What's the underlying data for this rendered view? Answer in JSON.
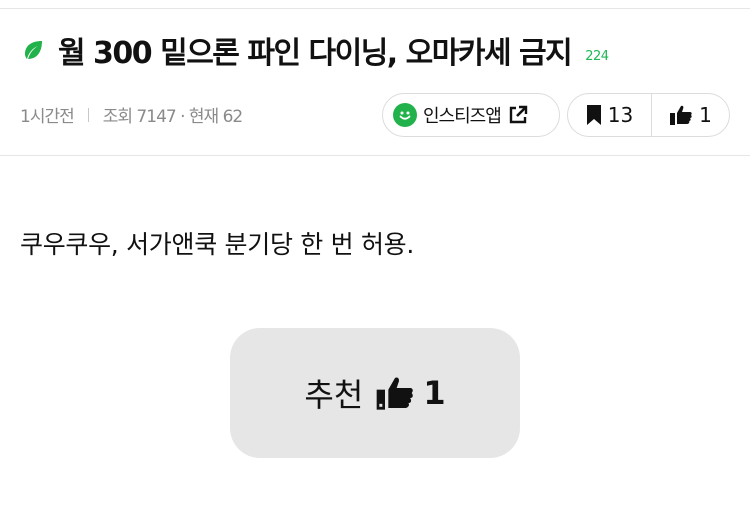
{
  "post": {
    "title": "월 300 밑으론 파인 다이닝, 오마카세 금지",
    "comment_count": "224",
    "meta": {
      "time": "1시간전",
      "stats": "조회 7147 · 현재 62"
    },
    "app_button": {
      "label": "인스티즈앱",
      "icon": "smile-icon",
      "ext_icon": "external-link-icon"
    },
    "bookmark_count": "13",
    "like_count": "1",
    "body_text": "쿠우쿠우, 서가앤쿡 분기당 한 번 허용.",
    "recommend": {
      "label": "추천",
      "count": "1"
    }
  },
  "colors": {
    "accent_green": "#1db954",
    "button_bg": "#e6e6e6",
    "meta_gray": "#8a8a8a"
  }
}
